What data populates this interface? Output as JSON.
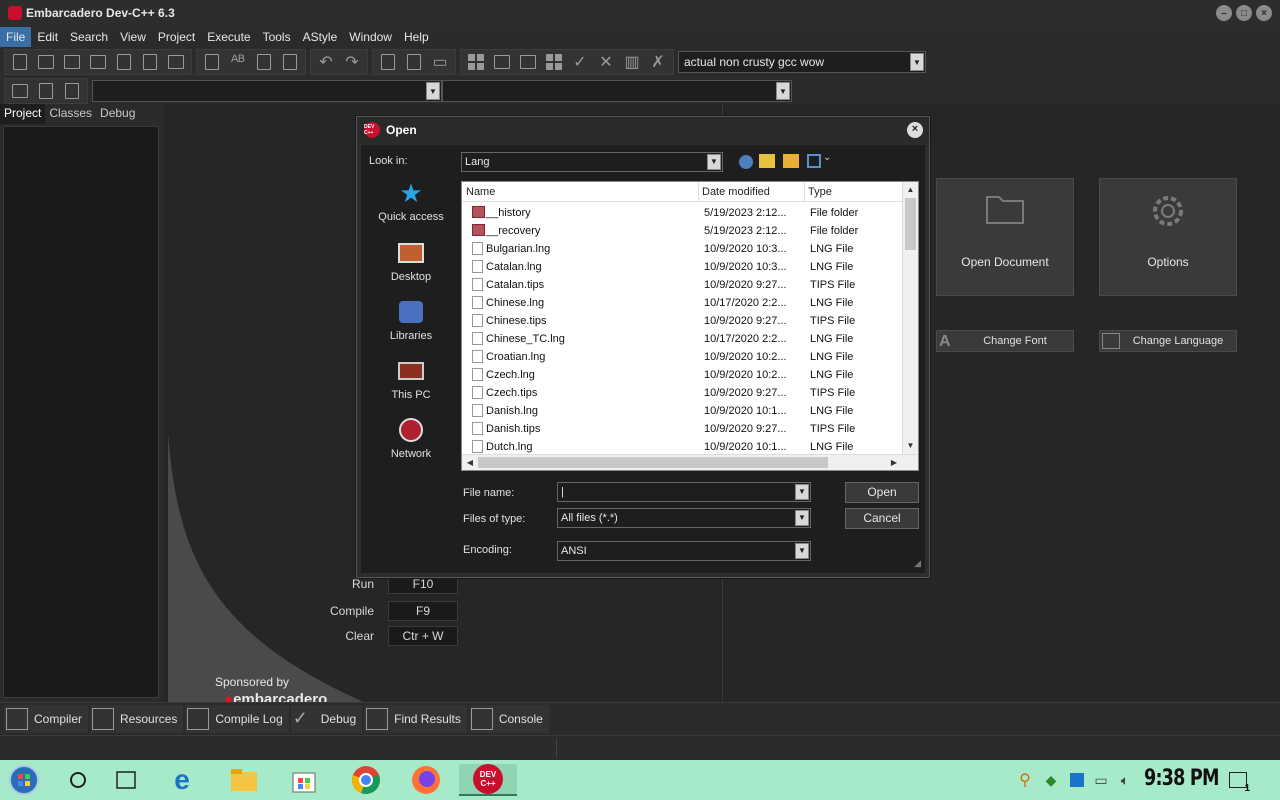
{
  "window": {
    "title": "Embarcadero Dev-C++ 6.3"
  },
  "menu": [
    "File",
    "Edit",
    "Search",
    "View",
    "Project",
    "Execute",
    "Tools",
    "AStyle",
    "Window",
    "Help"
  ],
  "toolbar": {
    "compiler_value": "actual non crusty gcc wow"
  },
  "left_tabs": [
    "Project",
    "Classes",
    "Debug"
  ],
  "welcome": {
    "open_document": "Open Document",
    "options": "Options",
    "change_font": "Change Font",
    "change_language": "Change Language",
    "shortcuts": [
      {
        "action": "Run",
        "key": "F10"
      },
      {
        "action": "Compile",
        "key": "F9"
      },
      {
        "action": "Clear",
        "key": "Ctr + W"
      }
    ],
    "sponsored_by": "Sponsored by",
    "sponsor_logo": "embarcadero"
  },
  "bottom_tabs": [
    "Compiler",
    "Resources",
    "Compile Log",
    "Debug",
    "Find Results",
    "Console"
  ],
  "dialog": {
    "title": "Open",
    "app_badge": "DEV C++",
    "look_in_label": "Look in:",
    "look_in_value": "Lang",
    "places": [
      "Quick access",
      "Desktop",
      "Libraries",
      "This PC",
      "Network"
    ],
    "columns": [
      "Name",
      "Date modified",
      "Type"
    ],
    "files": [
      {
        "name": "__history",
        "date": "5/19/2023 2:12...",
        "type": "File folder",
        "kind": "folder"
      },
      {
        "name": "__recovery",
        "date": "5/19/2023 2:12...",
        "type": "File folder",
        "kind": "folder"
      },
      {
        "name": "Bulgarian.lng",
        "date": "10/9/2020 10:3...",
        "type": "LNG File",
        "kind": "file"
      },
      {
        "name": "Catalan.lng",
        "date": "10/9/2020 10:3...",
        "type": "LNG File",
        "kind": "file"
      },
      {
        "name": "Catalan.tips",
        "date": "10/9/2020 9:27...",
        "type": "TIPS File",
        "kind": "file"
      },
      {
        "name": "Chinese.lng",
        "date": "10/17/2020 2:2...",
        "type": "LNG File",
        "kind": "file"
      },
      {
        "name": "Chinese.tips",
        "date": "10/9/2020 9:27...",
        "type": "TIPS File",
        "kind": "file"
      },
      {
        "name": "Chinese_TC.lng",
        "date": "10/17/2020 2:2...",
        "type": "LNG File",
        "kind": "file"
      },
      {
        "name": "Croatian.lng",
        "date": "10/9/2020 10:2...",
        "type": "LNG File",
        "kind": "file"
      },
      {
        "name": "Czech.lng",
        "date": "10/9/2020 10:2...",
        "type": "LNG File",
        "kind": "file"
      },
      {
        "name": "Czech.tips",
        "date": "10/9/2020 9:27...",
        "type": "TIPS File",
        "kind": "file"
      },
      {
        "name": "Danish.lng",
        "date": "10/9/2020 10:1...",
        "type": "LNG File",
        "kind": "file"
      },
      {
        "name": "Danish.tips",
        "date": "10/9/2020 9:27...",
        "type": "TIPS File",
        "kind": "file"
      },
      {
        "name": "Dutch.lng",
        "date": "10/9/2020 10:1...",
        "type": "LNG File",
        "kind": "file"
      }
    ],
    "file_name_label": "File name:",
    "file_name_value": "|",
    "files_of_type_label": "Files of type:",
    "files_of_type_value": "All files (*.*)",
    "encoding_label": "Encoding:",
    "encoding_value": "ANSI",
    "open_button": "Open",
    "cancel_button": "Cancel"
  },
  "taskbar": {
    "clock": "9:38 PM",
    "notification_count": "1",
    "devcpp_badge": "DEV C++"
  },
  "colors": {
    "accent": "#3a6ea5",
    "taskbar": "#a7eaca",
    "brand": "#c8102e"
  }
}
